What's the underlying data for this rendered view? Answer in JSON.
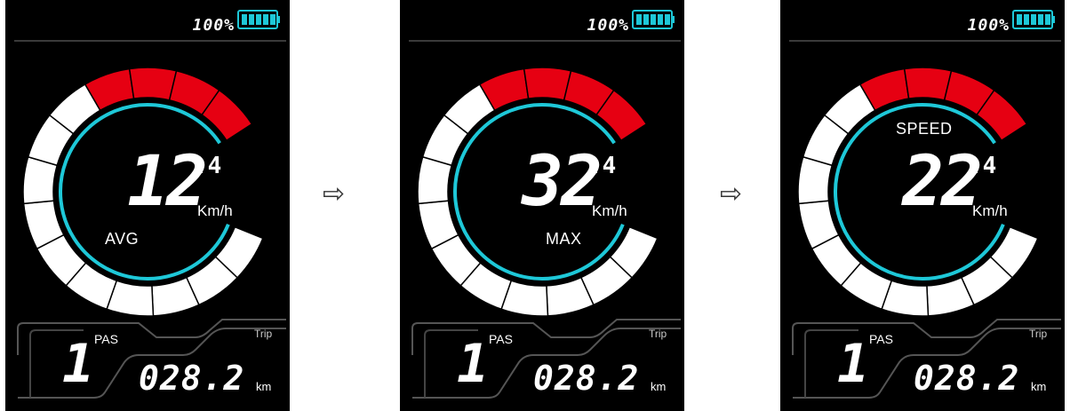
{
  "screens": [
    {
      "battery": "100%",
      "speed_integer": "12",
      "speed_decimal": ".4",
      "speed_unit": "Km/h",
      "mode_label": "AVG",
      "pas_label": "PAS",
      "pas_level": "1",
      "trip_label": "Trip",
      "odometer": "028.2",
      "odometer_unit": "km"
    },
    {
      "battery": "100%",
      "speed_integer": "32",
      "speed_decimal": ".4",
      "speed_unit": "Km/h",
      "mode_label": "MAX",
      "pas_label": "PAS",
      "pas_level": "1",
      "trip_label": "Trip",
      "odometer": "028.2",
      "odometer_unit": "km"
    },
    {
      "battery": "100%",
      "speed_integer": "22",
      "speed_decimal": ".4",
      "speed_unit": "Km/h",
      "mode_label": "SPEED",
      "pas_label": "PAS",
      "pas_level": "1",
      "trip_label": "Trip",
      "odometer": "028.2",
      "odometer_unit": "km"
    }
  ],
  "arrows": [
    "⇨",
    "⇨"
  ],
  "colors": {
    "gauge_white": "#ffffff",
    "gauge_red": "#e60012",
    "inner_ring_cyan": "#1ec8d8",
    "battery_cyan": "#1ec8d8",
    "screen_bg": "#000000"
  }
}
